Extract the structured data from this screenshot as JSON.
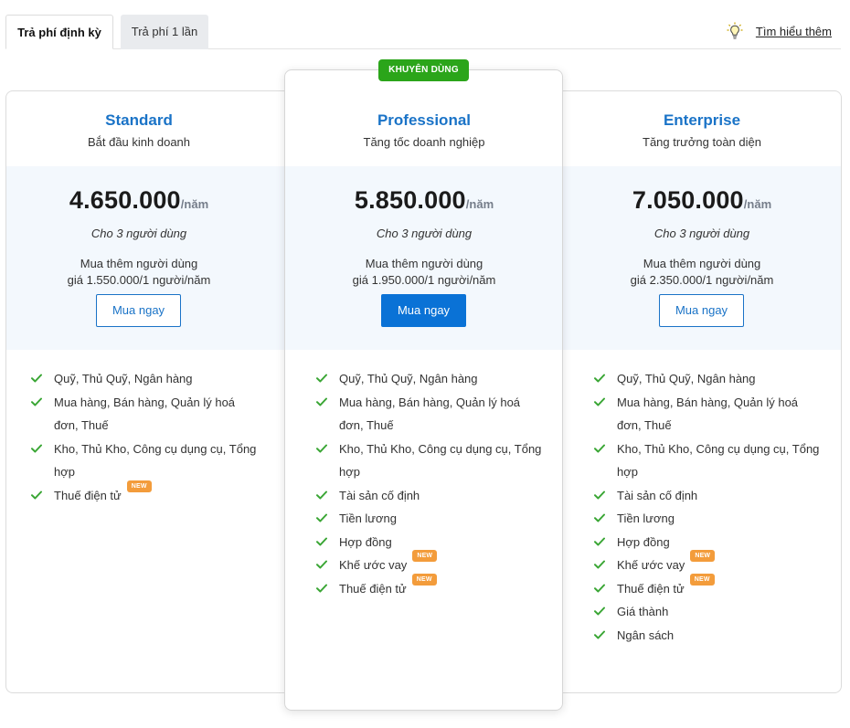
{
  "tabs": [
    {
      "label": "Trả phí định kỳ"
    },
    {
      "label": "Trả phí 1 lần"
    }
  ],
  "learn_more": {
    "label": "Tìm hiểu thêm",
    "icon": "lightbulb-icon"
  },
  "recommended_badge": "KHUYÊN DÙNG",
  "colors": {
    "accent": "#1a73c7",
    "button_primary": "#0a72d6",
    "badge_green": "#2ba51a",
    "new_badge": "#f39c3b",
    "check": "#3aa635"
  },
  "plans": [
    {
      "name": "Standard",
      "subtitle": "Bắt đầu kinh doanh",
      "price": "4.650.000",
      "period": "/năm",
      "users": "Cho 3 người dùng",
      "extra_line1": "Mua thêm người dùng",
      "extra_line2": "giá 1.550.000/1 người/năm",
      "button": "Mua ngay",
      "features": [
        {
          "label": "Quỹ, Thủ Quỹ, Ngân hàng",
          "new": ""
        },
        {
          "label": "Mua hàng, Bán hàng, Quản lý hoá đơn, Thuế",
          "new": ""
        },
        {
          "label": "Kho, Thủ Kho, Công cụ dụng cụ, Tổng hợp",
          "new": ""
        },
        {
          "label": "Thuế điện tử",
          "new": "NEW"
        }
      ]
    },
    {
      "name": "Professional",
      "subtitle": "Tăng tốc doanh nghiệp",
      "price": "5.850.000",
      "period": "/năm",
      "users": "Cho 3 người dùng",
      "extra_line1": "Mua thêm người dùng",
      "extra_line2": "giá 1.950.000/1 người/năm",
      "button": "Mua ngay",
      "features": [
        {
          "label": "Quỹ, Thủ Quỹ, Ngân hàng",
          "new": ""
        },
        {
          "label": "Mua hàng, Bán hàng, Quản lý hoá đơn, Thuế",
          "new": ""
        },
        {
          "label": "Kho, Thủ Kho, Công cụ dụng cụ, Tổng hợp",
          "new": ""
        },
        {
          "label": "Tài sản cố định",
          "new": ""
        },
        {
          "label": "Tiền lương",
          "new": ""
        },
        {
          "label": "Hợp đồng",
          "new": ""
        },
        {
          "label": "Khế ước vay",
          "new": "NEW"
        },
        {
          "label": "Thuế điện tử",
          "new": "NEW"
        }
      ]
    },
    {
      "name": "Enterprise",
      "subtitle": "Tăng trưởng toàn diện",
      "price": "7.050.000",
      "period": "/năm",
      "users": "Cho 3 người dùng",
      "extra_line1": "Mua thêm người dùng",
      "extra_line2": "giá 2.350.000/1 người/năm",
      "button": "Mua ngay",
      "features": [
        {
          "label": "Quỹ, Thủ Quỹ, Ngân hàng",
          "new": ""
        },
        {
          "label": "Mua hàng, Bán hàng, Quản lý hoá đơn, Thuế",
          "new": ""
        },
        {
          "label": "Kho, Thủ Kho, Công cụ dụng cụ, Tổng hợp",
          "new": ""
        },
        {
          "label": "Tài sản cố định",
          "new": ""
        },
        {
          "label": "Tiền lương",
          "new": ""
        },
        {
          "label": "Hợp đồng",
          "new": ""
        },
        {
          "label": "Khế ước vay",
          "new": "NEW"
        },
        {
          "label": "Thuế điện tử",
          "new": "NEW"
        },
        {
          "label": "Giá thành",
          "new": ""
        },
        {
          "label": "Ngân sách",
          "new": ""
        }
      ]
    }
  ]
}
